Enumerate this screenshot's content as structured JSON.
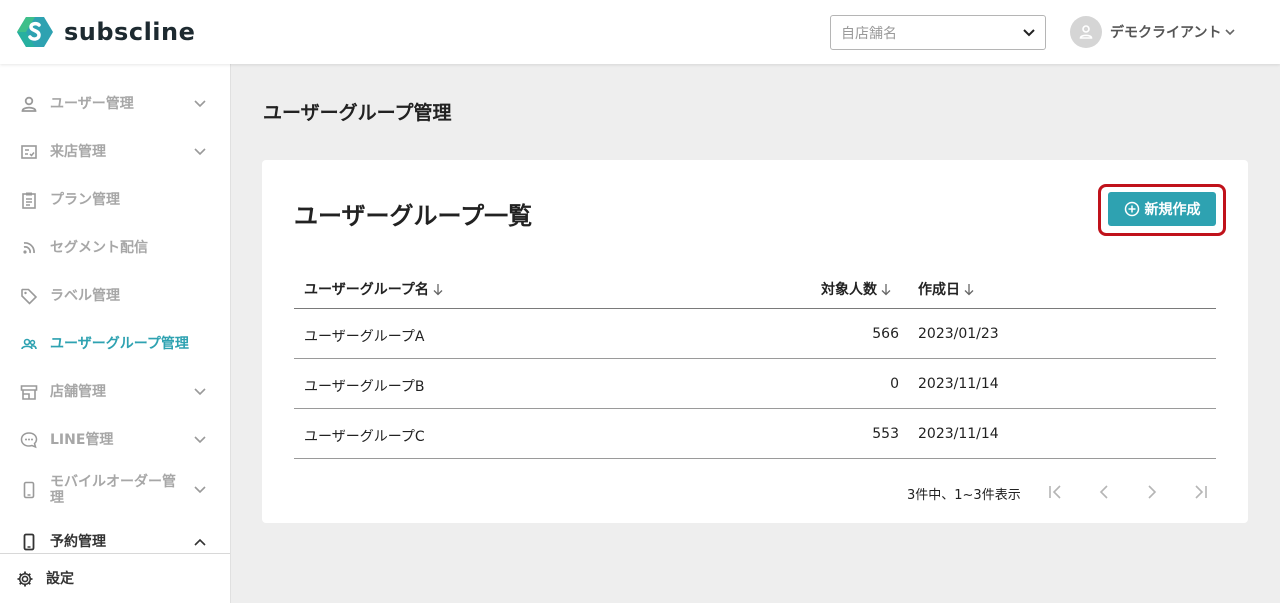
{
  "header": {
    "brand": "subscline",
    "store_placeholder": "自店舗名",
    "user_name": "デモクライアント"
  },
  "sidebar": {
    "items": [
      {
        "label": "ユーザー管理",
        "icon": "person-icon",
        "chevron": "down"
      },
      {
        "label": "来店管理",
        "icon": "checklist-icon",
        "chevron": "down"
      },
      {
        "label": "プラン管理",
        "icon": "clipboard-icon",
        "chevron": ""
      },
      {
        "label": "セグメント配信",
        "icon": "rss-icon",
        "chevron": ""
      },
      {
        "label": "ラベル管理",
        "icon": "tag-icon",
        "chevron": ""
      },
      {
        "label": "ユーザーグループ管理",
        "icon": "group-icon",
        "chevron": "",
        "active": true
      },
      {
        "label": "店舗管理",
        "icon": "store-icon",
        "chevron": "down"
      },
      {
        "label": "LINE管理",
        "icon": "chat-icon",
        "chevron": "down"
      },
      {
        "label": "モバイルオーダー管理",
        "icon": "phone-icon",
        "chevron": "down"
      },
      {
        "label": "予約管理",
        "icon": "phone-icon",
        "chevron": "up"
      }
    ],
    "settings_label": "設定"
  },
  "main": {
    "page_title": "ユーザーグループ管理",
    "card_title": "ユーザーグループ一覧",
    "new_button": "新規作成",
    "columns": [
      "ユーザーグループ名",
      "対象人数",
      "作成日"
    ],
    "rows": [
      {
        "name": "ユーザーグループA",
        "count": "566",
        "date": "2023/01/23"
      },
      {
        "name": "ユーザーグループB",
        "count": "0",
        "date": "2023/11/14"
      },
      {
        "name": "ユーザーグループC",
        "count": "553",
        "date": "2023/11/14"
      }
    ],
    "pagination_info": "3件中、1~3件表示"
  },
  "colors": {
    "accent": "#2ea2b1",
    "highlight_outline": "#c0121b",
    "nav_inactive": "#a7a7a7"
  }
}
